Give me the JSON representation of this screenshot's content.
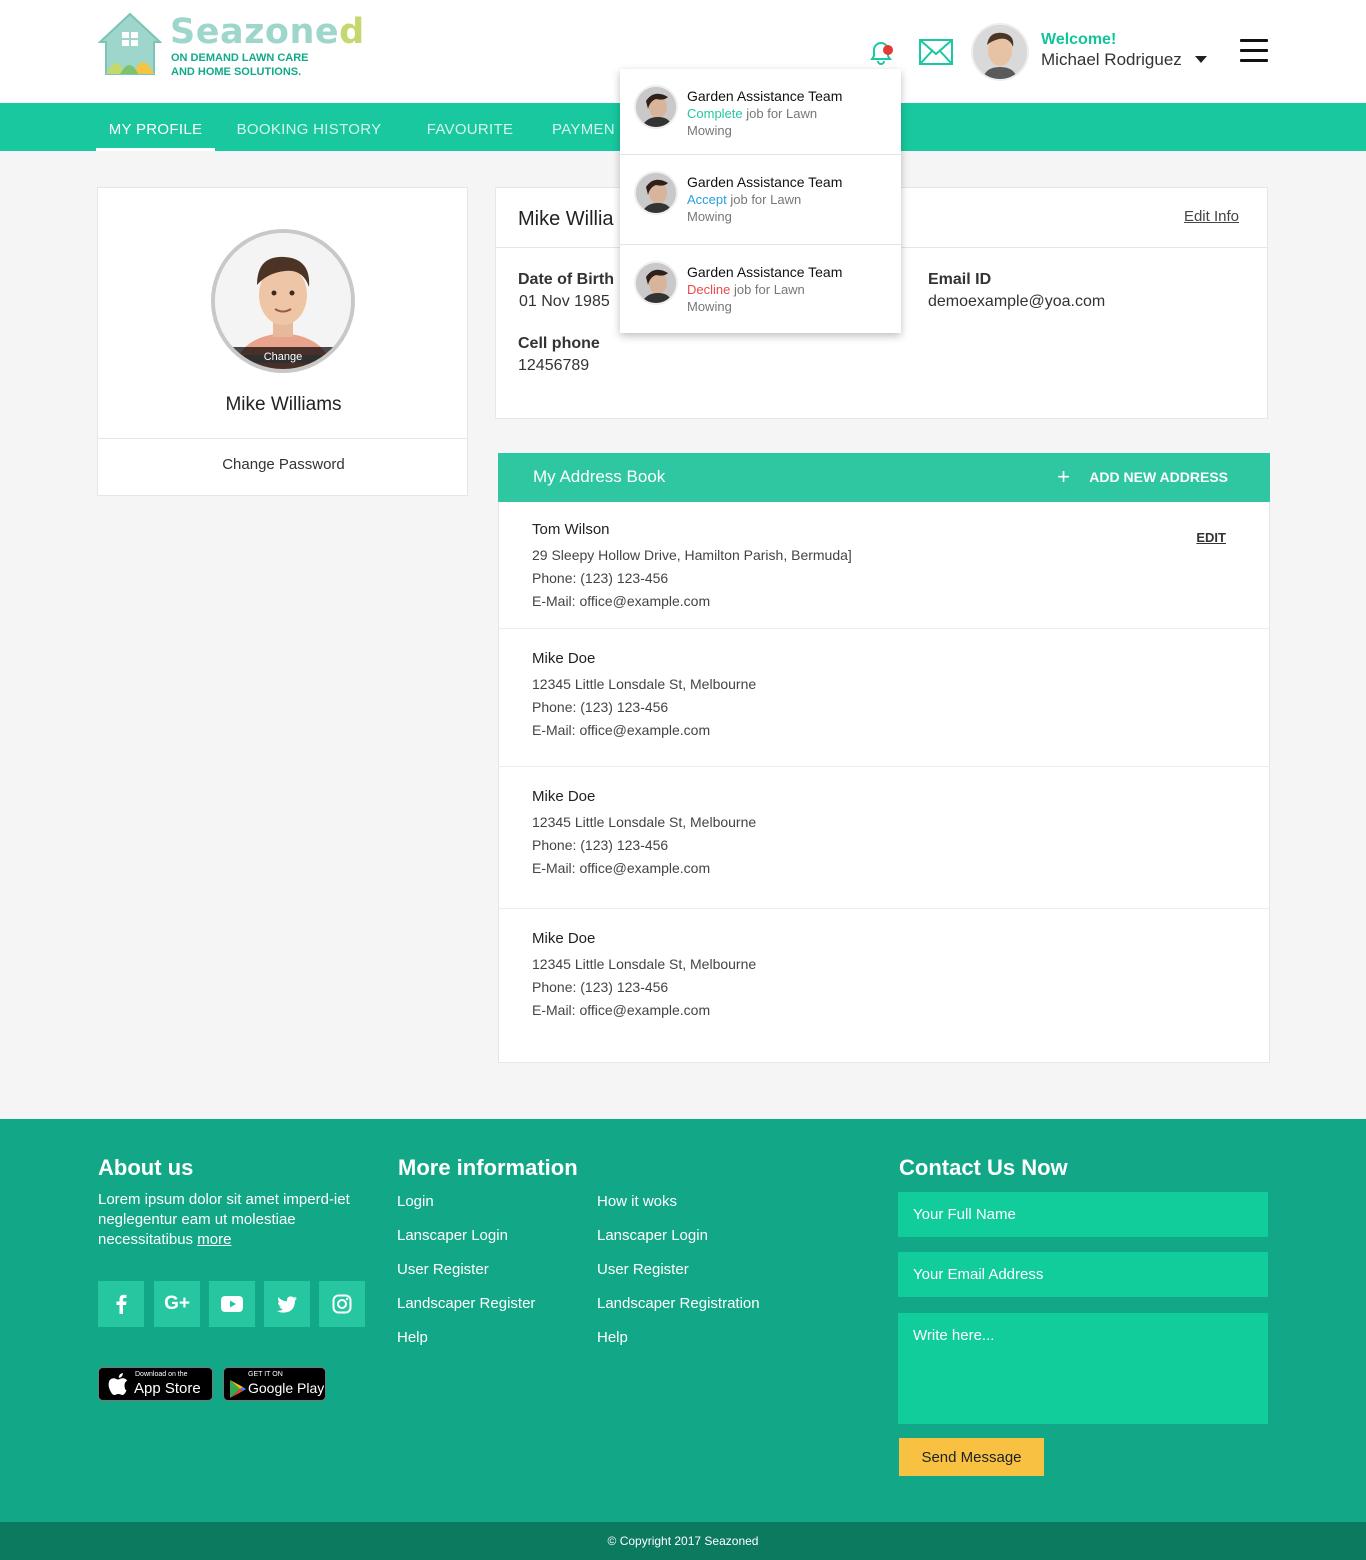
{
  "brand": {
    "name_main": "Seazone",
    "name_last": "d",
    "tagline_1": "ON DEMAND LAWN CARE",
    "tagline_2": "AND HOME SOLUTIONS."
  },
  "header": {
    "welcome": "Welcome!",
    "user_name": "Michael Rodriguez",
    "icons": [
      "bell-icon",
      "mail-icon",
      "caret-down-icon",
      "hamburger-icon"
    ]
  },
  "nav": {
    "items": [
      {
        "label": "MY PROFILE",
        "active": true
      },
      {
        "label": "BOOKING HISTORY",
        "active": false
      },
      {
        "label": "FAVOURITE",
        "active": false
      },
      {
        "label": "PAYMEN",
        "active": false
      }
    ]
  },
  "profile": {
    "name": "Mike Williams",
    "change_label": "Change",
    "change_password": "Change Password"
  },
  "info": {
    "title": "Mike Willia",
    "edit_label": "Edit Info",
    "dob_label": "Date of Birth",
    "dob_value": "01 Nov 1985",
    "email_label": "Email ID",
    "email_value": "demoexample@yoa.com",
    "phone_label": "Cell phone",
    "phone_value": "12456789"
  },
  "address_book": {
    "title": "My Address Book",
    "add_label": "ADD NEW ADDRESS",
    "edit_label": "EDIT",
    "entries": [
      {
        "name": "Tom Wilson",
        "address": "29 Sleepy Hollow Drive, Hamilton Parish, Bermuda]",
        "phone": "Phone: (123) 123-456",
        "email": "E-Mail: office@example.com"
      },
      {
        "name": "Mike Doe",
        "address": "12345 Little Lonsdale St, Melbourne",
        "phone": "Phone: (123) 123-456",
        "email": "E-Mail: office@example.com"
      },
      {
        "name": "Mike Doe",
        "address": "12345 Little Lonsdale St, Melbourne",
        "phone": "Phone: (123) 123-456",
        "email": "E-Mail: office@example.com"
      },
      {
        "name": "Mike Doe",
        "address": "12345 Little Lonsdale St, Melbourne",
        "phone": "Phone: (123) 123-456",
        "email": "E-Mail: office@example.com"
      }
    ]
  },
  "notifications": [
    {
      "team": "Garden Assistance Team",
      "status": "Complete",
      "rest_1": " job for Lawn",
      "rest_2": "Mowing",
      "status_color": "#25c6a3"
    },
    {
      "team": "Garden Assistance Team",
      "status": "Accept",
      "rest_1": " job for Lawn",
      "rest_2": "Mowing",
      "status_color": "#2b9ee0"
    },
    {
      "team": "Garden Assistance Team",
      "status": "Decline",
      "rest_1": " job for Lawn",
      "rest_2": "Mowing",
      "status_color": "#ea4a4a"
    }
  ],
  "footer": {
    "about_title": "About us",
    "about_text": "Lorem ipsum dolor sit amet imperd-iet neglegentur eam ut molestiae necessitatibus",
    "about_more": "more",
    "social_icons": [
      "facebook-icon",
      "google-plus-icon",
      "youtube-icon",
      "twitter-icon",
      "instagram-icon"
    ],
    "app_store_small": "Download on the",
    "app_store_big": "App Store",
    "google_play_small": "GET IT ON",
    "google_play_big": "Google Play",
    "more_title": "More information",
    "links_col1": [
      "Login",
      "Lanscaper Login",
      "User Register",
      "Landscaper Register",
      "Help"
    ],
    "links_col2": [
      "How it woks",
      "Lanscaper Login",
      "User Register",
      "Landscaper Registration",
      "Help"
    ],
    "contact_title": "Contact Us Now",
    "name_placeholder": "Your Full Name",
    "email_placeholder": "Your Email Address",
    "message_placeholder": "Write here...",
    "send_label": "Send Message",
    "copyright": "© Copyright 2017 Seazoned"
  },
  "colors": {
    "accent": "#19c89f",
    "footer": "#12a887",
    "footer_bottom": "#0c7a5f",
    "send_button": "#f8c142"
  }
}
